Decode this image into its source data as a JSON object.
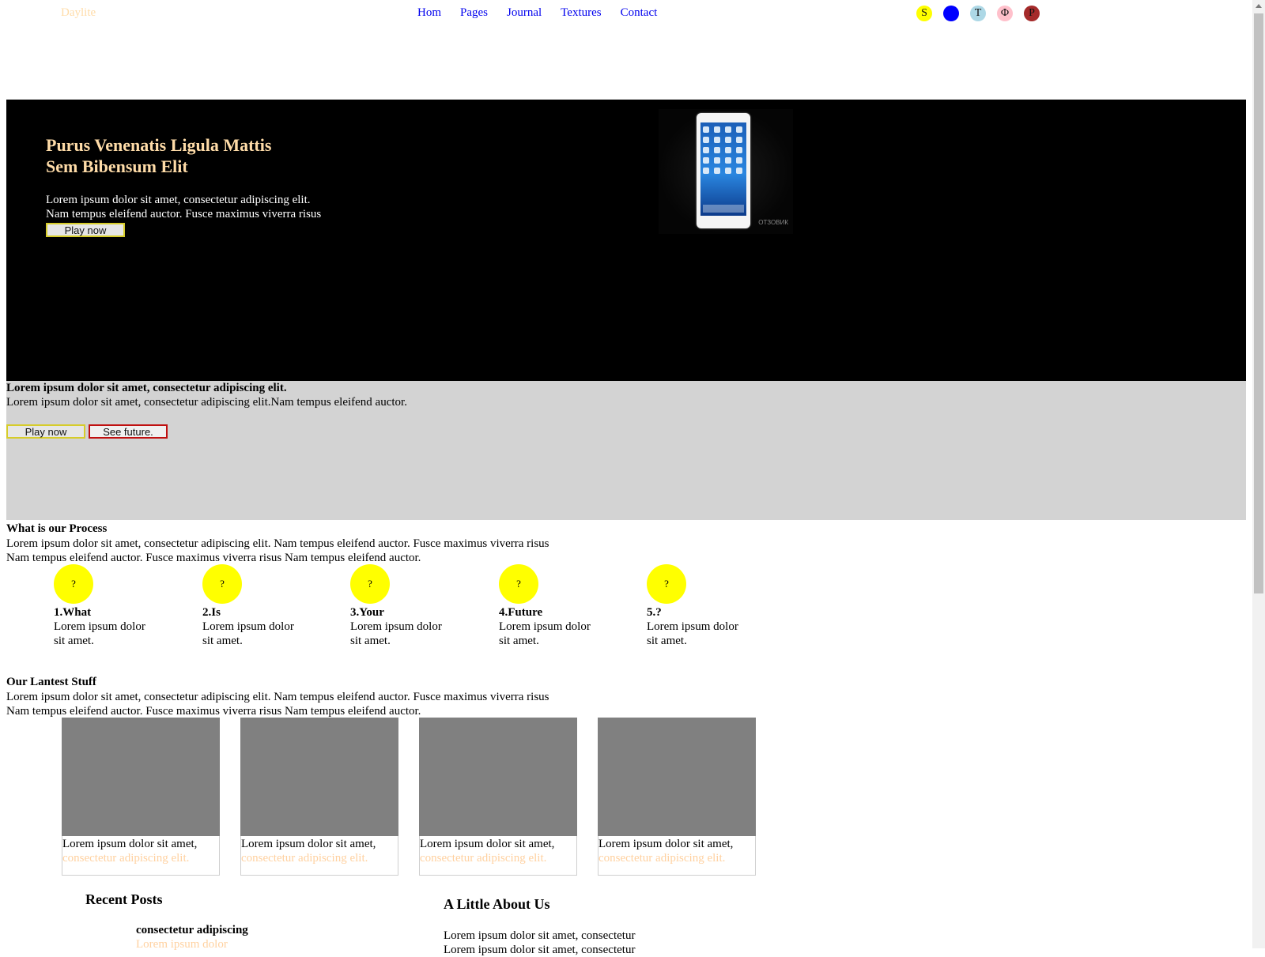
{
  "header": {
    "logo": "Daylite",
    "nav": [
      "Hom",
      "Pages",
      "Journal",
      "Textures",
      "Contact"
    ],
    "social": [
      {
        "glyph": "S",
        "color": "#ffff00",
        "icon": "s-social-icon"
      },
      {
        "glyph": "♪",
        "color": "#0000ff",
        "icon": "music-social-icon"
      },
      {
        "glyph": "T",
        "color": "#add8e6",
        "icon": "t-social-icon"
      },
      {
        "glyph": "Φ",
        "color": "#ffc0cb",
        "icon": "phi-social-icon"
      },
      {
        "glyph": "P",
        "color": "#a52a2a",
        "icon": "p-social-icon"
      }
    ]
  },
  "hero": {
    "title_line1": "Purus Venenatis Ligula Mattis",
    "title_line2": "Sem Bibensum Elit",
    "text_line1": "Lorem ipsum dolor sit amet, consectetur adipiscing elit.",
    "text_line2": "Nam tempus eleifend auctor. Fusce maximus viverra risus",
    "button": "Play now",
    "image_watermark": "ОТЗОВИК"
  },
  "band": {
    "bold": "Lorem ipsum dolor sit amet, consectetur adipiscing elit.",
    "text": "Lorem ipsum dolor sit amet, consectetur adipiscing elit.Nam tempus eleifend auctor.",
    "button1": "Play now",
    "button2": "See future."
  },
  "process": {
    "title": "What is our Process",
    "text_line1": "Lorem ipsum dolor sit amet, consectetur adipiscing elit. Nam tempus eleifend auctor. Fusce maximus viverra risus",
    "text_line2": "Nam tempus eleifend auctor. Fusce maximus viverra risus Nam tempus eleifend auctor.",
    "steps": [
      {
        "icon": "?",
        "title": "1.What",
        "text": "Lorem ipsum dolor sit amet."
      },
      {
        "icon": "?",
        "title": "2.Is",
        "text": "Lorem ipsum dolor sit amet."
      },
      {
        "icon": "?",
        "title": "3.Your",
        "text": "Lorem ipsum dolor sit amet."
      },
      {
        "icon": "?",
        "title": "4.Future",
        "text": "Lorem ipsum dolor sit amet."
      },
      {
        "icon": "?",
        "title": "5.?",
        "text": "Lorem ipsum dolor sit amet."
      }
    ]
  },
  "latest": {
    "title": "Our Lantest Stuff",
    "text_line1": "Lorem ipsum dolor sit amet, consectetur adipiscing elit. Nam tempus eleifend auctor. Fusce maximus viverra risus",
    "text_line2": "Nam tempus eleifend auctor. Fusce maximus viverra risus Nam tempus eleifend auctor.",
    "cards": [
      {
        "line1": "Lorem ipsum dolor sit amet,",
        "line2": "consectetur adipiscing elit."
      },
      {
        "line1": "Lorem ipsum dolor sit amet,",
        "line2": "consectetur adipiscing elit."
      },
      {
        "line1": "Lorem ipsum dolor sit amet,",
        "line2": "consectetur adipiscing elit."
      },
      {
        "line1": "Lorem ipsum dolor sit amet,",
        "line2": "consectetur adipiscing elit."
      }
    ]
  },
  "recent_posts": {
    "title": "Recent Posts",
    "post_title": "consectetur adipiscing",
    "post_sub": "Lorem ipsum dolor"
  },
  "about": {
    "title": "A Little About Us",
    "text_line1": "Lorem ipsum dolor sit amet, consectetur",
    "text_line2": "Lorem ipsum dolor sit amet, consectetur"
  }
}
